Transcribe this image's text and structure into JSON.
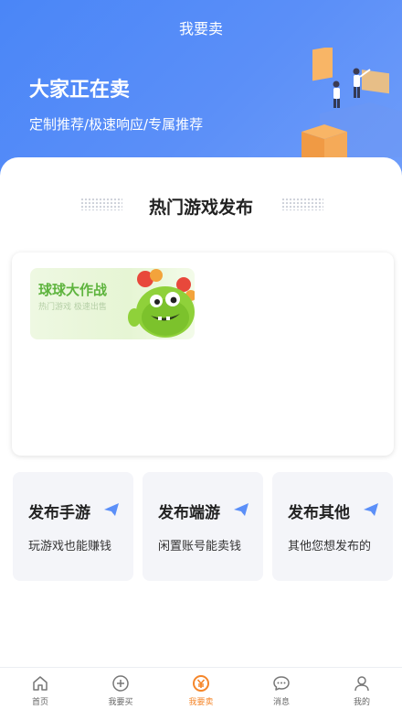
{
  "nav": {
    "title": "我要卖"
  },
  "hero": {
    "title": "大家正在卖",
    "subtitle": "定制推荐/极速响应/专属推荐"
  },
  "section": {
    "title": "热门游戏发布"
  },
  "hot_games": [
    {
      "name": "球球大作战",
      "tagline": "热门游戏 极速出售"
    }
  ],
  "publish_cards": [
    {
      "title": "发布手游",
      "subtitle": "玩游戏也能赚钱"
    },
    {
      "title": "发布端游",
      "subtitle": "闲置账号能卖钱"
    },
    {
      "title": "发布其他",
      "subtitle": "其他您想发布的"
    }
  ],
  "tabbar": {
    "items": [
      {
        "label": "首页",
        "icon": "home-icon"
      },
      {
        "label": "我要买",
        "icon": "plus-circle-icon"
      },
      {
        "label": "我要卖",
        "icon": "yen-circle-icon",
        "active": true
      },
      {
        "label": "消息",
        "icon": "chat-bubble-icon"
      },
      {
        "label": "我的",
        "icon": "user-icon"
      }
    ]
  },
  "colors": {
    "brand_blue": "#4a86f7",
    "accent_orange": "#f5862a",
    "plane_blue": "#5b8ff8",
    "game_green": "#5eb43e"
  }
}
